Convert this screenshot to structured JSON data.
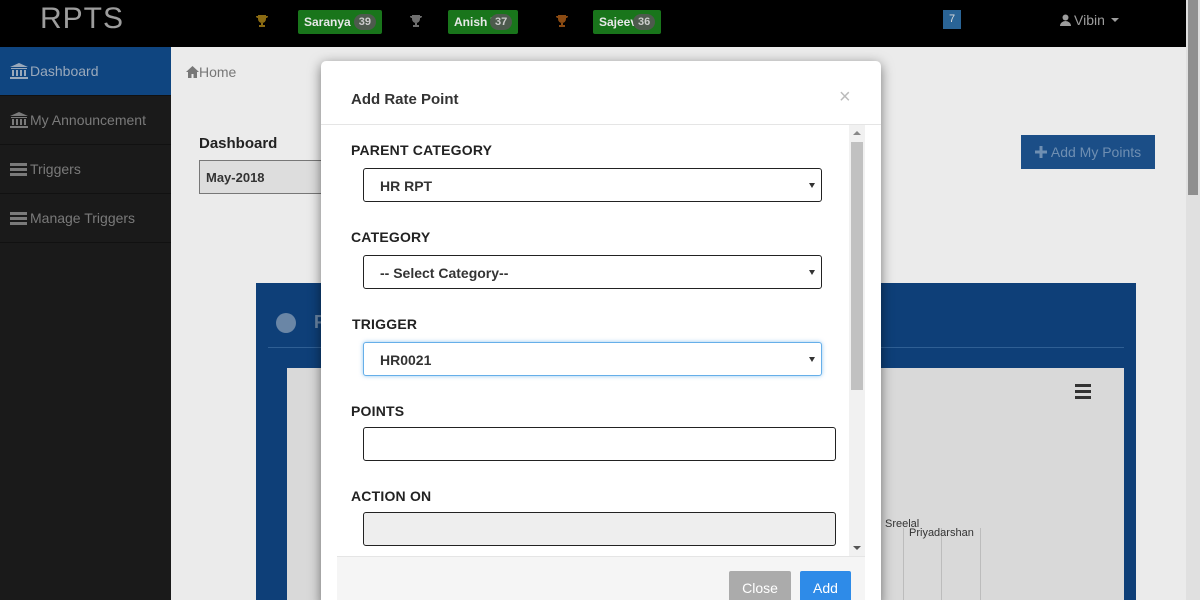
{
  "app": {
    "brand": "RPTS"
  },
  "leaders": [
    {
      "name": "Saranya",
      "count": "39"
    },
    {
      "name": "Anish T",
      "count": "37"
    },
    {
      "name": "Sajeev",
      "count": "36"
    }
  ],
  "notification_count": "7",
  "user": {
    "name": "Vibin"
  },
  "sidebar": {
    "items": [
      {
        "label": "Dashboard",
        "icon": "bank-icon",
        "active": true
      },
      {
        "label": "My Announcement",
        "icon": "bank-icon"
      },
      {
        "label": "Triggers",
        "icon": "list-icon"
      },
      {
        "label": "Manage Triggers",
        "icon": "list-icon"
      }
    ]
  },
  "breadcrumb": {
    "home": "Home"
  },
  "dashboard": {
    "title": "Dashboard",
    "month": "May-2018",
    "add_points_label": "Add My Points",
    "panel_title_initial": "F",
    "chart_labels": [
      "Sreelal",
      "Priyadarshan"
    ]
  },
  "modal": {
    "title": "Add Rate Point",
    "close_symbol": "×",
    "fields": {
      "parent_category": {
        "label": "PARENT CATEGORY",
        "value": "HR RPT"
      },
      "category": {
        "label": "CATEGORY",
        "value": "-- Select Category--"
      },
      "trigger": {
        "label": "TRIGGER",
        "value": "HR0021"
      },
      "points": {
        "label": "POINTS",
        "value": ""
      },
      "action_on": {
        "label": "ACTION ON",
        "value": ""
      }
    },
    "buttons": {
      "close": "Close",
      "add": "Add"
    }
  },
  "colors": {
    "topbar": "#000000",
    "sidebar_active": "#0f4580",
    "leader_pill": "#19751b",
    "add_button": "#2e8be8",
    "close_button": "#ababab",
    "focus_border": "#66afe9"
  }
}
